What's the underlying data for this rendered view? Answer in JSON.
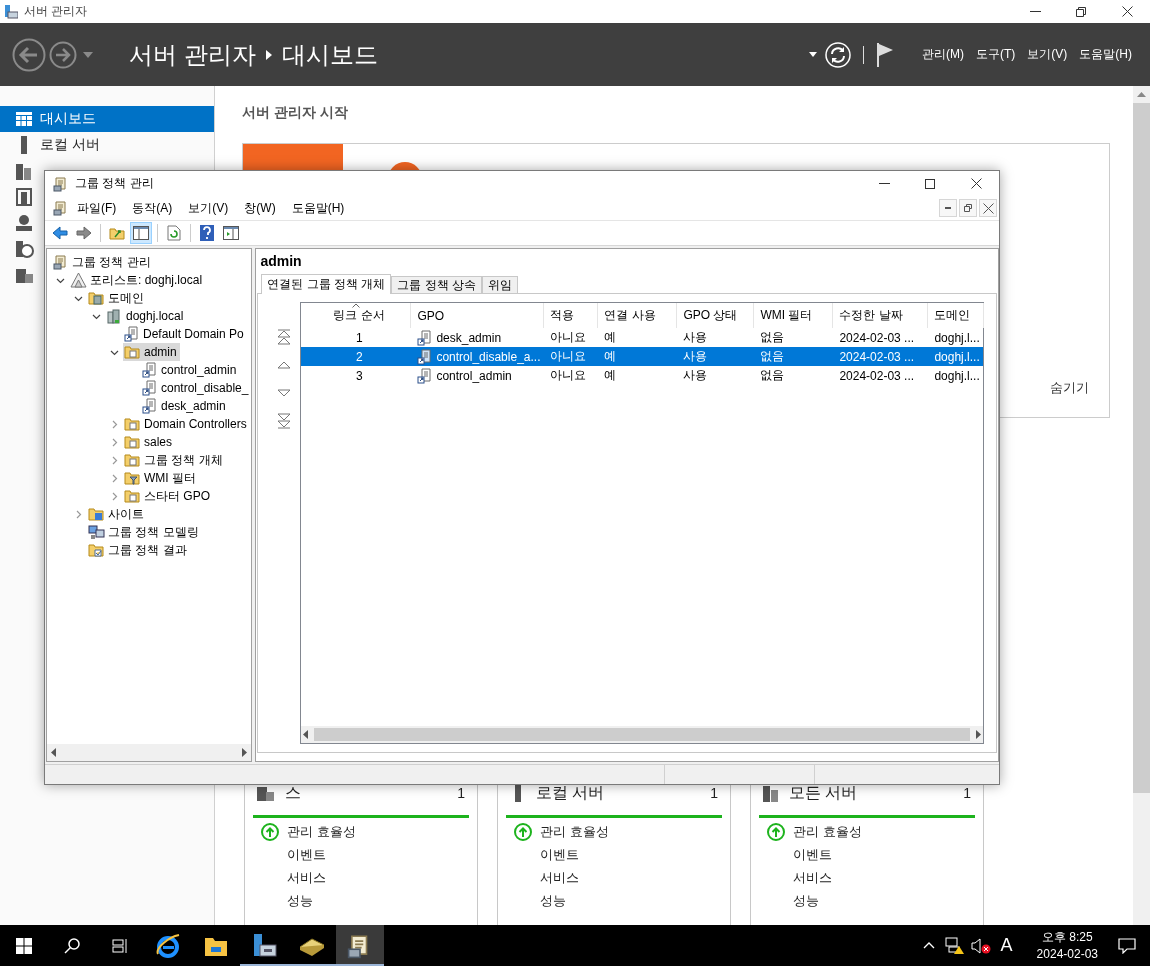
{
  "window": {
    "title": "서버 관리자"
  },
  "header": {
    "breadcrumb": [
      "서버 관리자",
      "대시보드"
    ],
    "menus": [
      "관리(M)",
      "도구(T)",
      "보기(V)",
      "도움말(H)"
    ]
  },
  "sidebar": {
    "items": [
      {
        "label": "대시보드",
        "kind": "dashboard",
        "selected": true
      },
      {
        "label": "로컬 서버",
        "kind": "local-server",
        "selected": false
      },
      {
        "kind": "all-servers",
        "selected": false
      },
      {
        "kind": "directory",
        "selected": false
      },
      {
        "kind": "dns",
        "selected": false
      },
      {
        "kind": "web",
        "selected": false
      },
      {
        "kind": "files",
        "selected": false
      }
    ]
  },
  "welcome": {
    "heading": "서버 관리자 시작",
    "hide_link": "숨기기"
  },
  "tiles": [
    {
      "kind": "files",
      "title": "스",
      "count": "1",
      "items": [
        {
          "label": "관리 효율성",
          "kind": "status"
        },
        {
          "label": "이벤트",
          "kind": "plain"
        },
        {
          "label": "서비스",
          "kind": "plain"
        },
        {
          "label": "성능",
          "kind": "plain"
        }
      ]
    },
    {
      "kind": "local-server",
      "title": "로컬 서버",
      "count": "1",
      "items": [
        {
          "label": "관리 효율성",
          "kind": "status"
        },
        {
          "label": "이벤트",
          "kind": "plain"
        },
        {
          "label": "서비스",
          "kind": "plain"
        },
        {
          "label": "성능",
          "kind": "plain"
        }
      ]
    },
    {
      "kind": "all-servers",
      "title": "모든 서버",
      "count": "1",
      "items": [
        {
          "label": "관리 효율성",
          "kind": "status"
        },
        {
          "label": "이벤트",
          "kind": "plain"
        },
        {
          "label": "서비스",
          "kind": "plain"
        },
        {
          "label": "성능",
          "kind": "plain"
        }
      ]
    }
  ],
  "gpm": {
    "title": "그룹 정책 관리",
    "menus": [
      "파일(F)",
      "동작(A)",
      "보기(V)",
      "창(W)",
      "도움말(H)"
    ],
    "tree": [
      {
        "label": "그룹 정책 관리",
        "kind": "root",
        "selected": false,
        "children": [
          {
            "label": "포리스트: doghj.local",
            "kind": "forest",
            "selected": false,
            "expanded": true,
            "children": [
              {
                "label": "도메인",
                "kind": "domains",
                "selected": false,
                "expanded": true,
                "children": [
                  {
                    "label": "doghj.local",
                    "kind": "domain",
                    "selected": false,
                    "expanded": true,
                    "children": [
                      {
                        "label": "Default Domain Po",
                        "kind": "link",
                        "selected": false
                      },
                      {
                        "label": "admin",
                        "kind": "ou",
                        "selected": true,
                        "expanded": true,
                        "children": [
                          {
                            "label": "control_admin",
                            "kind": "link",
                            "selected": false
                          },
                          {
                            "label": "control_disable_",
                            "kind": "link",
                            "selected": false
                          },
                          {
                            "label": "desk_admin",
                            "kind": "link",
                            "selected": false
                          }
                        ]
                      },
                      {
                        "label": "Domain Controllers",
                        "kind": "ou",
                        "selected": false,
                        "expanded": false
                      },
                      {
                        "label": "sales",
                        "kind": "ou",
                        "selected": false,
                        "expanded": false
                      },
                      {
                        "label": "그룹 정책 개체",
                        "kind": "gpos",
                        "selected": false,
                        "expanded": false
                      },
                      {
                        "label": "WMI 필터",
                        "kind": "wmi",
                        "selected": false,
                        "expanded": false
                      },
                      {
                        "label": "스타터 GPO",
                        "kind": "starter",
                        "selected": false,
                        "expanded": false
                      }
                    ]
                  }
                ]
              },
              {
                "label": "사이트",
                "kind": "sites",
                "selected": false,
                "expanded": false
              },
              {
                "label": "그룹 정책 모델링",
                "kind": "modeling",
                "selected": false
              },
              {
                "label": "그룹 정책 결과",
                "kind": "results",
                "selected": false
              }
            ]
          }
        ]
      }
    ],
    "detail": {
      "title": "admin",
      "tabs": [
        {
          "label": "연결된 그룹 정책 개체",
          "selected": true
        },
        {
          "label": "그룹 정책 상속",
          "selected": false
        },
        {
          "label": "위임",
          "selected": false
        }
      ],
      "columns": [
        "링크 순서",
        "GPO",
        "적용",
        "연결 사용",
        "GPO 상태",
        "WMI 필터",
        "수정한 날짜",
        "도메인"
      ],
      "rows": [
        {
          "selected": false,
          "cells": [
            "1",
            "desk_admin",
            "아니요",
            "예",
            "사용",
            "없음",
            "2024-02-03 ...",
            "doghj.l..."
          ]
        },
        {
          "selected": true,
          "cells": [
            "2",
            "control_disable_a...",
            "아니요",
            "예",
            "사용",
            "없음",
            "2024-02-03 ...",
            "doghj.l..."
          ]
        },
        {
          "selected": false,
          "cells": [
            "3",
            "control_admin",
            "아니요",
            "예",
            "사용",
            "없음",
            "2024-02-03 ...",
            "doghj.l..."
          ]
        }
      ]
    }
  },
  "taskbar": {
    "apps": [
      {
        "kind": "start",
        "running": false,
        "active": false
      },
      {
        "kind": "search",
        "running": false,
        "active": false
      },
      {
        "kind": "task-view",
        "running": false,
        "active": false
      },
      {
        "kind": "browser",
        "running": false,
        "active": false
      },
      {
        "kind": "explorer",
        "running": false,
        "active": false
      },
      {
        "kind": "server-manager",
        "running": true,
        "active": false
      },
      {
        "kind": "book",
        "running": true,
        "active": false
      },
      {
        "kind": "gpm",
        "running": true,
        "active": true
      }
    ],
    "tray": {
      "keyboard": "A",
      "time": "오후 8:25",
      "date": "2024-02-03"
    }
  }
}
